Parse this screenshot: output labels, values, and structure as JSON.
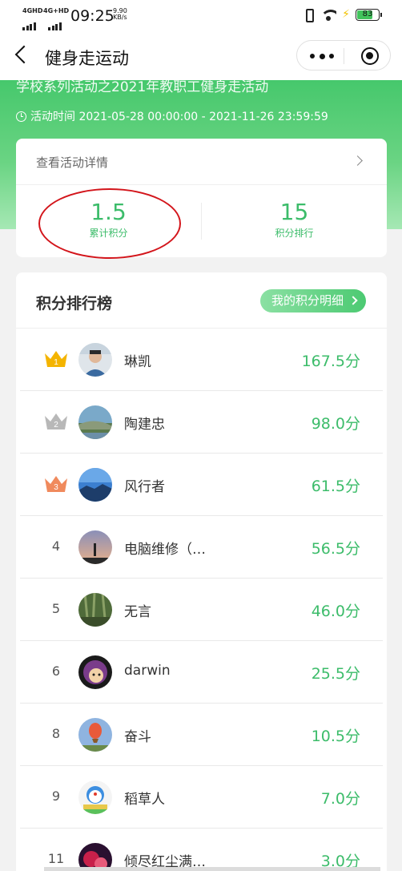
{
  "status_bar": {
    "network1": "4GHD",
    "network2": "4G+HD",
    "time": "09:25",
    "speed_value": "9.90",
    "speed_unit": "KB/s",
    "battery": "83"
  },
  "nav": {
    "title": "健身走运动"
  },
  "banner": {
    "title": "学校系列活动之2021年教职工健身走活动",
    "activity_time": "活动时间 2021-05-28 00:00:00 - 2021-11-26 23:59:59"
  },
  "summary": {
    "detail_link": "查看活动详情",
    "total_points_value": "1.5",
    "total_points_label": "累计积分",
    "rank_value": "15",
    "rank_label": "积分排行"
  },
  "ranking": {
    "title": "积分排行榜",
    "my_detail_button": "我的积分明细",
    "rows": [
      {
        "rank": "1",
        "name": "琳凯",
        "points": "167.5分",
        "crown": "gold"
      },
      {
        "rank": "2",
        "name": "陶建忠",
        "points": "98.0分",
        "crown": "silver"
      },
      {
        "rank": "3",
        "name": "风行者",
        "points": "61.5分",
        "crown": "bronze"
      },
      {
        "rank": "4",
        "name": "电脑维修（…",
        "points": "56.5分"
      },
      {
        "rank": "5",
        "name": "无言",
        "points": "46.0分"
      },
      {
        "rank": "6",
        "name": "darwin",
        "points": "25.5分"
      },
      {
        "rank": "8",
        "name": "奋斗",
        "points": "10.5分"
      },
      {
        "rank": "9",
        "name": "稻草人",
        "points": "7.0分"
      },
      {
        "rank": "11",
        "name": "倾尽红尘满…",
        "points": "3.0分"
      }
    ]
  },
  "colors": {
    "accent_green": "#3cbc6a",
    "banner_green": "#46c86c",
    "crown_gold": "#f4b400",
    "crown_silver": "#b8b8b8",
    "crown_bronze": "#f08a5d",
    "annotation_red": "#d3151b"
  }
}
